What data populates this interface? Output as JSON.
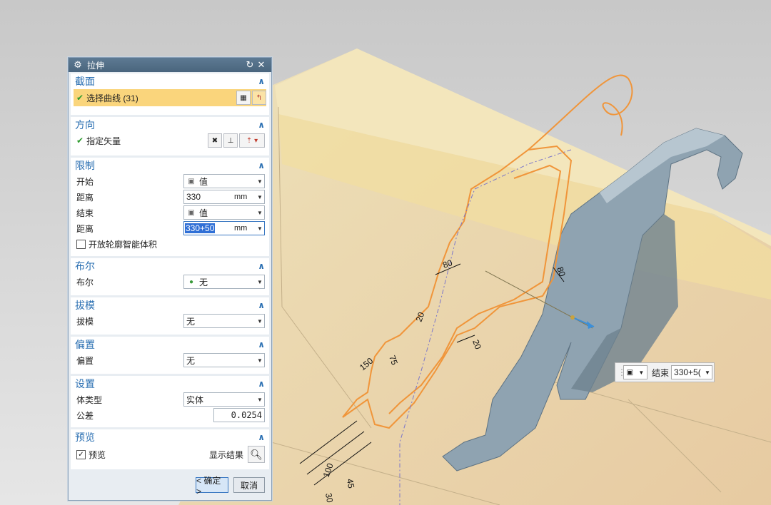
{
  "dialog": {
    "title": "拉伸",
    "sections": {
      "section": {
        "title": "截面",
        "select_curve": "选择曲线 (31)"
      },
      "direction": {
        "title": "方向",
        "vector": "指定矢量"
      },
      "limits": {
        "title": "限制",
        "start_label": "开始",
        "start_value": "值",
        "distance1_label": "距离",
        "distance1_value": "330",
        "distance1_unit": "mm",
        "end_label": "结束",
        "end_value": "值",
        "distance2_label": "距离",
        "distance2_value": "330+50",
        "distance2_unit": "mm",
        "open_profile": "开放轮廓智能体积"
      },
      "boolean": {
        "title": "布尔",
        "label": "布尔",
        "value": "无"
      },
      "draft": {
        "title": "拔模",
        "label": "拔模",
        "value": "无"
      },
      "offset": {
        "title": "偏置",
        "label": "偏置",
        "value": "无"
      },
      "settings": {
        "title": "设置",
        "body_type_label": "体类型",
        "body_type_value": "实体",
        "tolerance_label": "公差",
        "tolerance_value": "0.0254"
      },
      "preview": {
        "title": "预览",
        "preview_label": "预览",
        "show_result": "显示结果"
      }
    },
    "ok": "< 确定 >",
    "cancel": "取消"
  },
  "mini_toolbar": {
    "label": "结束",
    "value": "330+5("
  },
  "dimensions": [
    "80",
    "80",
    "20",
    "20",
    "150",
    "75",
    "100",
    "45",
    "30"
  ],
  "colors": {
    "title_bar": "#4f6b84",
    "section_text": "#2a6fb2",
    "selection": "#fad57c",
    "sketch": "#f0953a",
    "part": "#8fa3b1"
  }
}
